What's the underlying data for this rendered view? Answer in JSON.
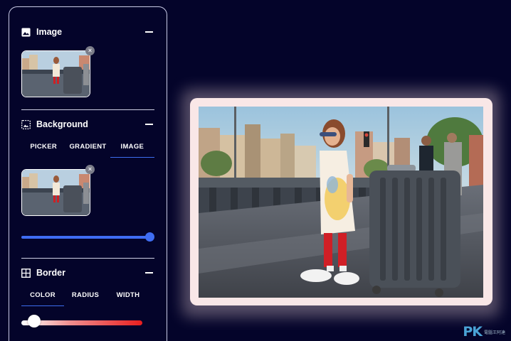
{
  "sections": {
    "image": {
      "title": "Image",
      "remove_glyph": "×"
    },
    "background": {
      "title": "Background",
      "tabs": [
        {
          "label": "PICKER",
          "active": false
        },
        {
          "label": "GRADIENT",
          "active": false
        },
        {
          "label": "IMAGE",
          "active": true
        }
      ],
      "remove_glyph": "×",
      "blur_level": 1.0
    },
    "border": {
      "title": "Border",
      "tabs": [
        {
          "label": "COLOR",
          "active": true
        },
        {
          "label": "RADIUS",
          "active": false
        },
        {
          "label": "WIDTH",
          "active": false
        }
      ],
      "color_level": 0.05
    }
  },
  "colors": {
    "background": "#04042a",
    "accent": "#3f6df2",
    "frame": "#f9e7e7"
  },
  "watermark": {
    "logo": "PK",
    "sub": "電腦王阿達"
  },
  "icons": {
    "image": "image-icon",
    "background": "background-image-icon",
    "border": "border-grid-icon",
    "collapse": "minus-icon",
    "remove": "close-icon"
  }
}
